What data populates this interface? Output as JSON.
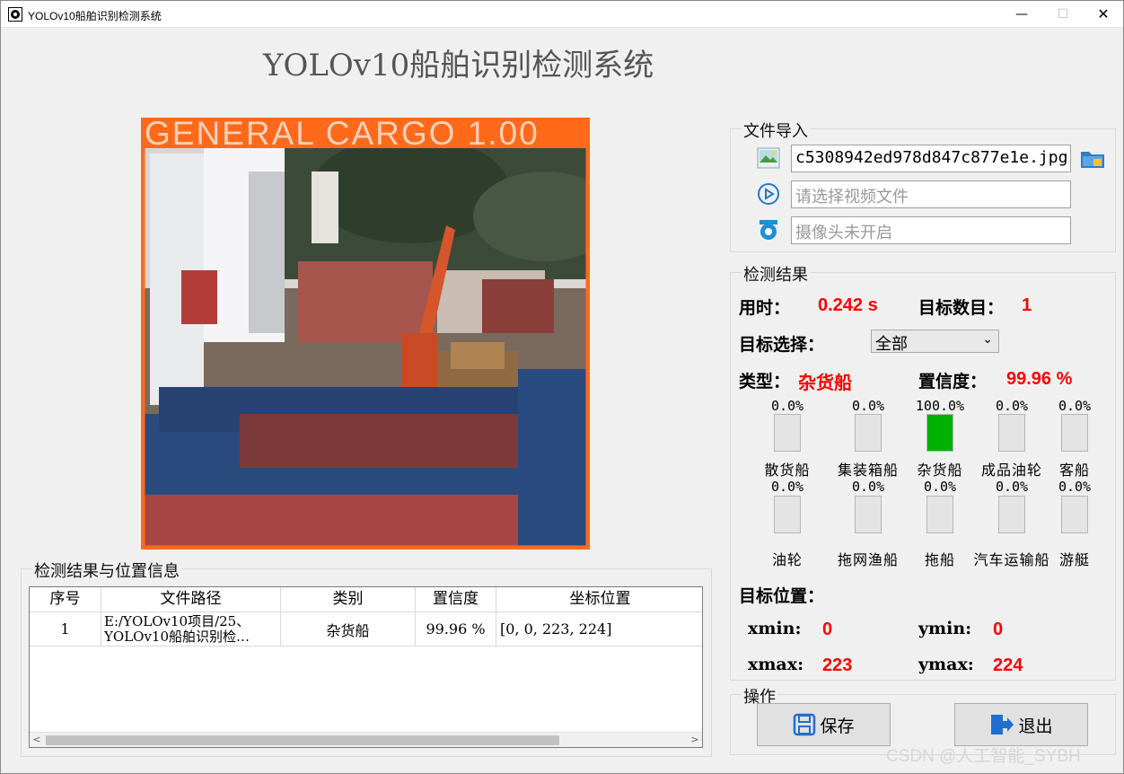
{
  "window": {
    "title": "YOLOv10船舶识别检测系统",
    "min_glyph": "—",
    "max_glyph": "☐",
    "close_glyph": "✕"
  },
  "header": {
    "title": "YOLOv10船舶识别检测系统"
  },
  "image_view": {
    "label_text": "GENERAL CARGO 1.00",
    "box_color": "#ff6a1a"
  },
  "file_import": {
    "group_title": "文件导入",
    "image_path_value": "c5308942ed978d847c877e1e.jpg",
    "video_placeholder": "请选择视频文件",
    "camera_placeholder": "摄像头未开启",
    "icons": [
      "image-icon",
      "folder-icon",
      "play-circle-icon",
      "camera-icon"
    ]
  },
  "results": {
    "group_title": "检测结果",
    "time_label": "用时：",
    "time_value": "0.242 s",
    "count_label": "目标数目：",
    "count_value": "1",
    "target_select_label": "目标选择：",
    "target_select_value": "全部",
    "type_label": "类型：",
    "type_value": "杂货船",
    "confidence_label": "置信度：",
    "confidence_value": "99.96 %",
    "class_bars": [
      {
        "label": "散货船",
        "pct_text": "0.0%",
        "fraction": 0.0
      },
      {
        "label": "集装箱船",
        "pct_text": "0.0%",
        "fraction": 0.0
      },
      {
        "label": "杂货船",
        "pct_text": "100.0%",
        "fraction": 1.0
      },
      {
        "label": "成品油轮",
        "pct_text": "0.0%",
        "fraction": 0.0
      },
      {
        "label": "客船",
        "pct_text": "0.0%",
        "fraction": 0.0
      },
      {
        "label": "油轮",
        "pct_text": "0.0%",
        "fraction": 0.0
      },
      {
        "label": "拖网渔船",
        "pct_text": "0.0%",
        "fraction": 0.0
      },
      {
        "label": "拖船",
        "pct_text": "0.0%",
        "fraction": 0.0
      },
      {
        "label": "汽车运输船",
        "pct_text": "0.0%",
        "fraction": 0.0
      },
      {
        "label": "游艇",
        "pct_text": "0.0%",
        "fraction": 0.0
      }
    ],
    "bar_fill_color": "#00b000",
    "position_label": "目标位置：",
    "xmin_label": "xmin:",
    "xmin_value": "0",
    "ymin_label": "ymin:",
    "ymin_value": "0",
    "xmax_label": "xmax:",
    "xmax_value": "223",
    "ymax_label": "ymax:",
    "ymax_value": "224"
  },
  "operations": {
    "group_title": "操作",
    "save_label": "保存",
    "exit_label": "退出"
  },
  "table": {
    "group_title": "检测结果与位置信息",
    "columns": [
      "序号",
      "文件路径",
      "类别",
      "置信度",
      "坐标位置"
    ],
    "rows": [
      {
        "index": "1",
        "path_line1": "E:/YOLOv10项目/25、",
        "path_line2": "YOLOv10船舶识别检…",
        "category": "杂货船",
        "confidence": "99.96 %",
        "coords": "[0, 0, 223, 224]"
      }
    ]
  },
  "watermark": "CSDN @人工智能_SYBH"
}
